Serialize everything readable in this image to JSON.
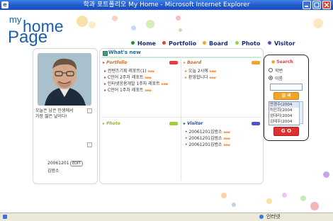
{
  "window": {
    "title": "학과 포트폴리오 My Home - Microsoft Internet Explorer",
    "ie_glyph": "e"
  },
  "logo": {
    "my": "my",
    "home": "home",
    "page": "Page"
  },
  "nav": [
    {
      "label": "Home",
      "color": "#1e8f3a"
    },
    {
      "label": "Portfolio",
      "color": "#e83b3b"
    },
    {
      "label": "Board",
      "color": "#f2a52a"
    },
    {
      "label": "Photo",
      "color": "#9fcf3a"
    },
    {
      "label": "Visitor",
      "color": "#4a55c8"
    }
  ],
  "profile": {
    "greeting": "오늘은 남은 인생에서 가장 젊은 날이다!",
    "student_id": "20061201",
    "student_name": "김범소",
    "edit_label": "EDIT"
  },
  "whats_new": {
    "title": "What's new"
  },
  "portfolio": {
    "title": "Portfolio",
    "more": "more",
    "items": [
      "컨텐츠기획 레포트(1)",
      "C언어 2주차 레포트",
      "인터넷응용개발 1주차 레포트",
      "C언어 1주차 레포트"
    ]
  },
  "board": {
    "title": "Board",
    "more": "more",
    "items": [
      "오늘 2시에",
      "환영합니다"
    ]
  },
  "photo": {
    "title": "Photo",
    "more": "more"
  },
  "visitor": {
    "title": "Visitor",
    "more": "more",
    "items": [
      "20061201김범소",
      "20061201김범소",
      "20061201김범소"
    ]
  },
  "new_badge": "new",
  "search": {
    "title": "Search",
    "options": [
      "학번",
      "이름"
    ],
    "selected": "이름",
    "input_value": "",
    "search_button": "검 색",
    "results": [
      "안경수(2004",
      "허진희(2004",
      "엄대리(2004",
      "김태우(2004"
    ],
    "go_button": "G O"
  },
  "status": {
    "zone": "인터넷"
  },
  "colors": {
    "accent_orange": "#f2a52a",
    "go_red": "#e03030",
    "logo_blue": "#1a5fa8"
  }
}
